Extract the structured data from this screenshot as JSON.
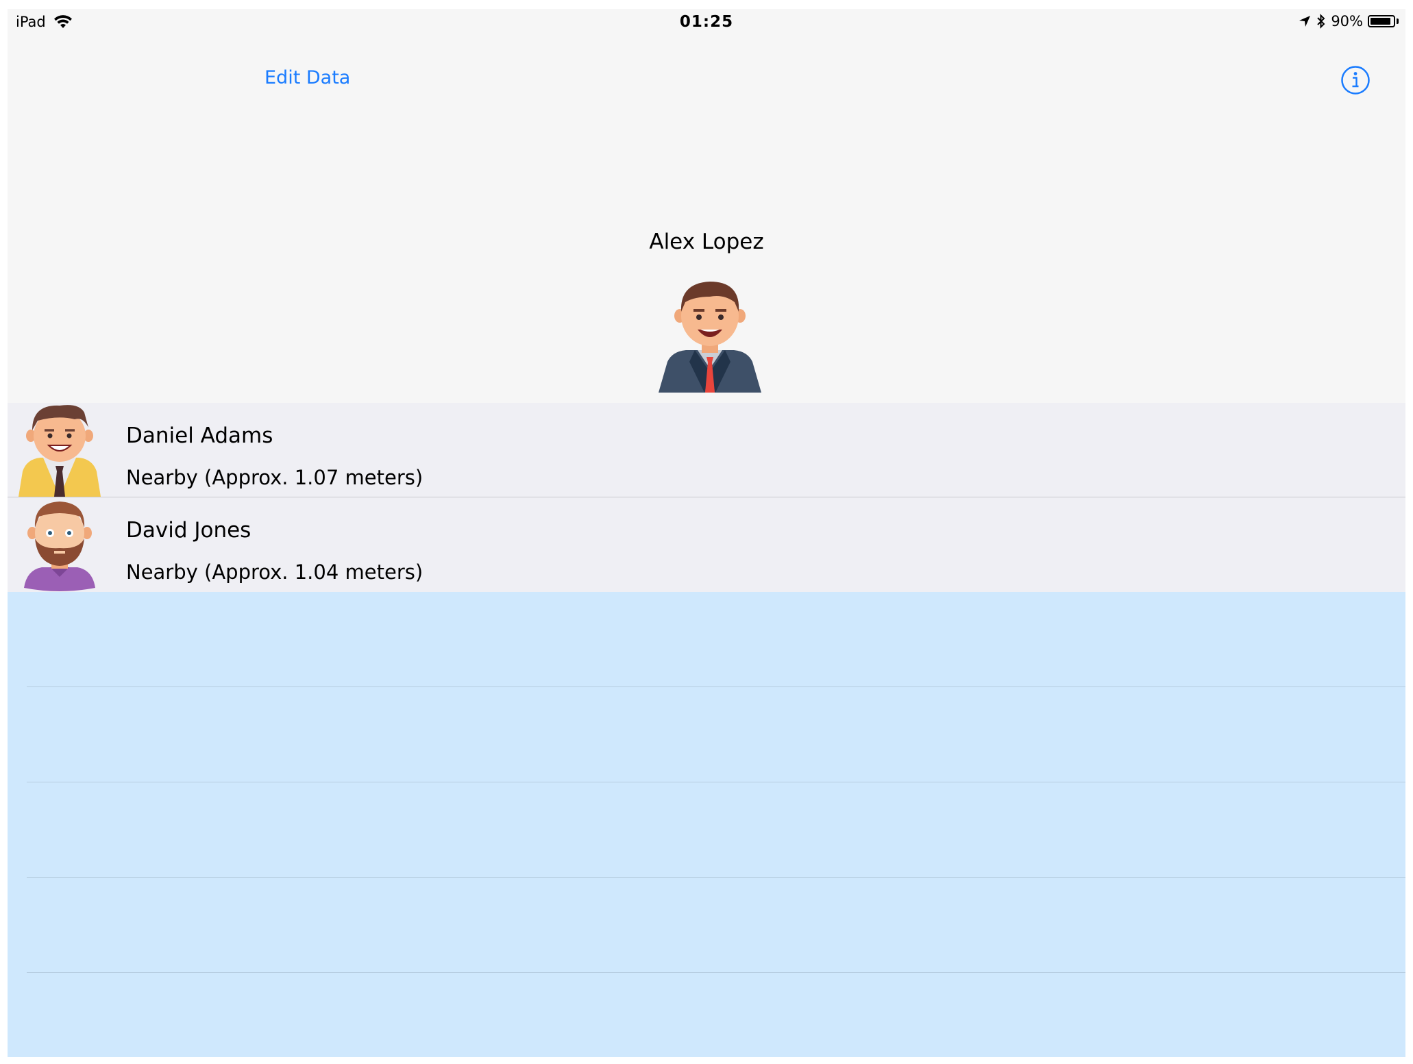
{
  "status_bar": {
    "device": "iPad",
    "time": "01:25",
    "battery_percent": "90%",
    "battery_level": 0.9
  },
  "nav": {
    "edit_label": "Edit Data",
    "info_icon": "info-circle-icon",
    "accent_color": "#1a7cff"
  },
  "profile": {
    "name": "Alex Lopez"
  },
  "contacts": [
    {
      "name": "Daniel Adams",
      "status": "Nearby (Approx. 1.07 meters)"
    },
    {
      "name": "David Jones",
      "status": "Nearby (Approx. 1.04 meters)"
    }
  ],
  "colors": {
    "list_background": "#efeff4",
    "empty_area": "#cfe8fd"
  }
}
